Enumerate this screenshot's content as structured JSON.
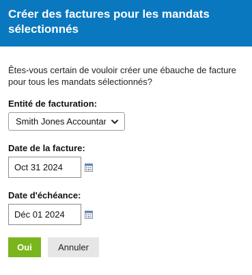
{
  "dialog": {
    "title": "Créer des factures pour les mandats sélectionnés",
    "prompt": "Êtes-vous certain de vouloir créer une ébauche de facture pour tous les mandats sélectionnés?",
    "colors": {
      "header_bg": "#0a78be",
      "primary_button": "#7ab51d",
      "secondary_button": "#e6e6e6"
    }
  },
  "billing_entity": {
    "label": "Entité de facturation:",
    "selected": "Smith Jones Accountants"
  },
  "invoice_date": {
    "label": "Date de la facture:",
    "value": "Oct 31 2024",
    "icon": "calendar-icon"
  },
  "due_date": {
    "label": "Date d'échéance:",
    "value": "Déc 01 2024",
    "icon": "calendar-icon"
  },
  "buttons": {
    "ok_label": "Oui",
    "cancel_label": "Annuler"
  }
}
